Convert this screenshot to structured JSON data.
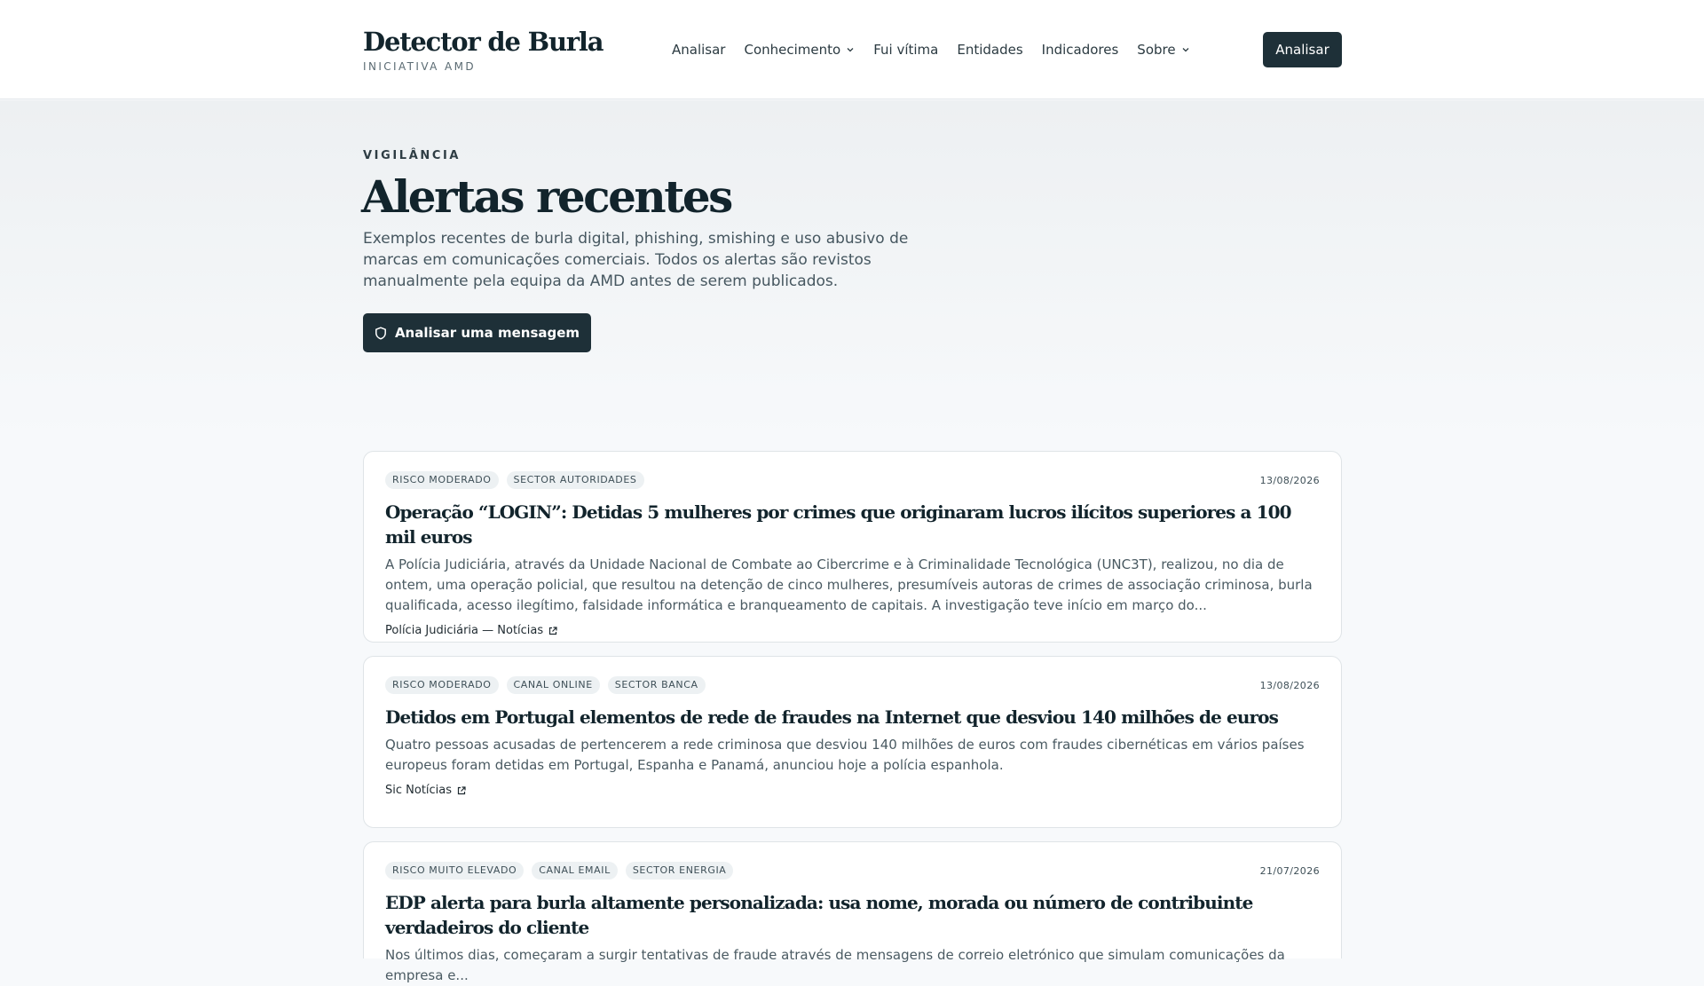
{
  "header": {
    "brand_title": "Detector de Burla",
    "brand_subtitle": "INICIATIVA AMD",
    "nav": [
      {
        "label": "Analisar",
        "dropdown": false
      },
      {
        "label": "Conhecimento",
        "dropdown": true
      },
      {
        "label": "Fui vítima",
        "dropdown": false
      },
      {
        "label": "Entidades",
        "dropdown": false
      },
      {
        "label": "Indicadores",
        "dropdown": false
      },
      {
        "label": "Sobre",
        "dropdown": true
      }
    ],
    "cta_label": "Analisar"
  },
  "hero": {
    "eyebrow": "VIGILÂNCIA",
    "title": "Alertas recentes",
    "description": "Exemplos recentes de burla digital, phishing, smishing e uso abusivo de marcas em comunicações comerciais. Todos os alertas são revistos manualmente pela equipa da AMD antes de serem publicados.",
    "button_label": "Analisar uma mensagem",
    "button_icon": "shield-icon"
  },
  "alerts": [
    {
      "tags": [
        "RISCO MODERADO",
        "SECTOR AUTORIDADES"
      ],
      "date": "13/08/2026",
      "title": "Operação “LOGIN”: Detidas 5 mulheres por crimes que originaram lucros ilícitos superiores a 100 mil euros",
      "body": "A Polícia Judiciária, através da Unidade Nacional de Combate ao Cibercrime e à Criminalidade Tecnológica (UNC3T), realizou, no dia de ontem, uma operação policial, que resultou na detenção de cinco mulheres, presumíveis autoras de crimes de associação criminosa, burla qualificada, acesso ilegítimo, falsidade informática e branqueamento de capitais. A investigação teve início em março do...",
      "source": "Polícia Judiciária — Notícias"
    },
    {
      "tags": [
        "RISCO MODERADO",
        "CANAL ONLINE",
        "SECTOR BANCA"
      ],
      "date": "13/08/2026",
      "title": "Detidos em Portugal elementos de rede de fraudes na Internet que desviou 140 milhões de euros",
      "body": "Quatro pessoas acusadas de pertencerem a rede criminosa que desviou 140 milhões de euros com fraudes cibernéticas em vários países europeus foram detidas em Portugal, Espanha e Panamá, anunciou hoje a polícia espanhola.",
      "source": "Sic Notícias"
    },
    {
      "tags": [
        "RISCO MUITO ELEVADO",
        "CANAL EMAIL",
        "SECTOR ENERGIA"
      ],
      "date": "21/07/2026",
      "title": "EDP alerta para burla altamente personalizada: usa nome, morada ou número de contribuinte verdadeiros do cliente",
      "body": "Nos últimos dias, começaram a surgir tentativas de fraude através de mensagens de correio eletrónico que simulam comunicações da empresa e...",
      "source": ""
    }
  ]
}
